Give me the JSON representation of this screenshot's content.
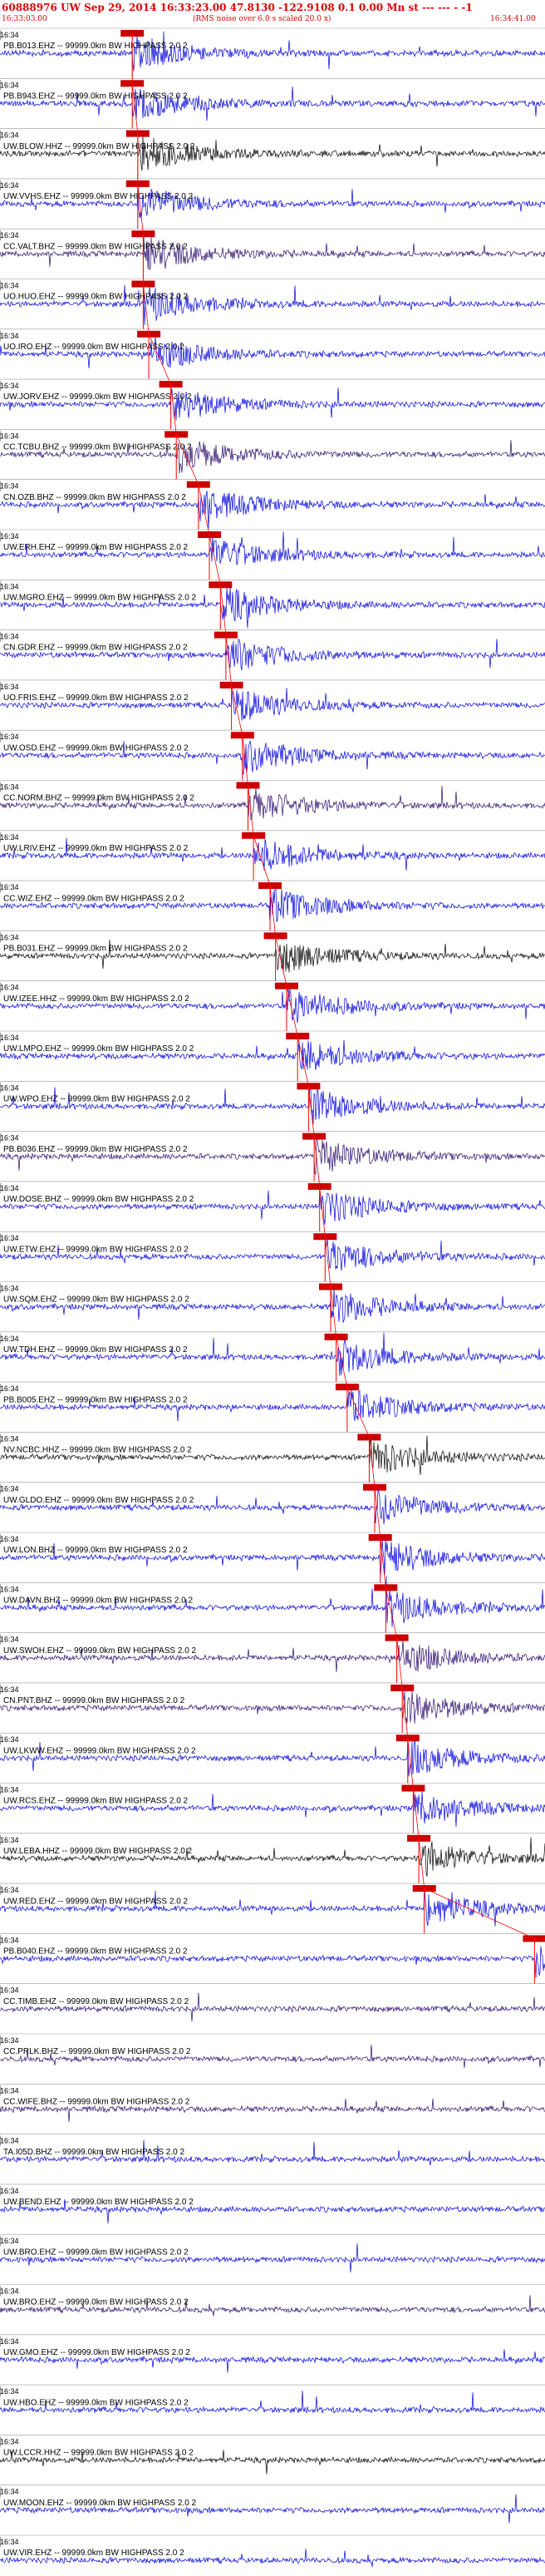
{
  "header": {
    "title": "60888976 UW Sep 29, 2014 16:33:23.00   47.8130 -122.9108  0.1 0.00 Mn st --- --- - -1",
    "start_time": "16:33:03.00",
    "rms_note": "(RMS noise over 6.0 s scaled 20.0 x)",
    "end_time": "16:34:41.00"
  },
  "colors": {
    "header": "#e00000",
    "pick": "#ff0000",
    "pick_box": "#cc0000",
    "traces": [
      "#0000dd",
      "#0000dd",
      "#000000",
      "#0000dd",
      "#2a0a6b",
      "#0000dd",
      "#0000dd",
      "#0000dd",
      "#2a0a6b",
      "#0000dd"
    ]
  },
  "minute_tick_label": "16:34",
  "chart_data": {
    "type": "seismogram_stack",
    "x_label": "",
    "x_range": [
      "16:33:03.00",
      "16:34:41.00"
    ],
    "minute_marker": "16:34",
    "traces": [
      {
        "label": "PB.B013.EHZ -- 99999.0km BW  HIGHPASS  2.0  2",
        "color": "#0000dd",
        "pick": "16:33:27"
      },
      {
        "label": "PB.B943.EHZ -- 99999.0km BW  HIGHPASS  2.0  2",
        "color": "#0000dd",
        "pick": "16:33:27"
      },
      {
        "label": "UW.BLOW.HHZ -- 99999.0km BW  HIGHPASS  2.0  2",
        "color": "#000000",
        "pick": "16:33:28"
      },
      {
        "label": "UW.VVHS.EHZ -- 99999.0km BW  HIGHPASS  2.0  2",
        "color": "#0000dd",
        "pick": "16:33:28"
      },
      {
        "label": "CC.VALT.BHZ -- 99999.0km BW  HIGHPASS  2.0  2",
        "color": "#2a0a6b",
        "pick": "16:33:29"
      },
      {
        "label": "UO.HUO.EHZ -- 99999.0km BW  HIGHPASS  2.0  2",
        "color": "#0000dd",
        "pick": "16:33:29"
      },
      {
        "label": "UO.IRO.EHZ -- 99999.0km BW  HIGHPASS  2.0  2",
        "color": "#0000dd",
        "pick": "16:33:30"
      },
      {
        "label": "UW.JORV.EHZ -- 99999.0km BW  HIGHPASS  2.0  2",
        "color": "#0000dd",
        "pick": "16:33:34"
      },
      {
        "label": "CC.TCBU.BHZ -- 99999.0km BW  HIGHPASS  2.0  2",
        "color": "#2a0a6b",
        "pick": "16:33:35"
      },
      {
        "label": "CN.OZB.BHZ -- 99999.0km BW  HIGHPASS  2.0  2",
        "color": "#0000dd",
        "pick": "16:33:39"
      },
      {
        "label": "UW.ERH.EHZ -- 99999.0km BW  HIGHPASS  2.0  2",
        "color": "#0000dd",
        "pick": "16:33:41"
      },
      {
        "label": "UW.MGRO.EHZ -- 99999.0km BW  HIGHPASS  2.0  2",
        "color": "#0000dd",
        "pick": "16:33:43"
      },
      {
        "label": "CN.GDR.EHZ -- 99999.0km BW  HIGHPASS  2.0  2",
        "color": "#0000dd",
        "pick": "16:33:44"
      },
      {
        "label": "UO.FRIS.EHZ -- 99999.0km BW  HIGHPASS  2.0  2",
        "color": "#0000dd",
        "pick": "16:33:45"
      },
      {
        "label": "UW.OSD.EHZ -- 99999.0km BW  HIGHPASS  2.0  2",
        "color": "#0000dd",
        "pick": "16:33:47"
      },
      {
        "label": "CC.NORM.BHZ -- 99999.0km BW  HIGHPASS  2.0  2",
        "color": "#2a0a6b",
        "pick": "16:33:48"
      },
      {
        "label": "UW.LRIV.EHZ -- 99999.0km BW  HIGHPASS  2.0  2",
        "color": "#0000dd",
        "pick": "16:33:49"
      },
      {
        "label": "CC.WIZ.EHZ -- 99999.0km BW  HIGHPASS  2.0  2",
        "color": "#0000dd",
        "pick": "16:33:52"
      },
      {
        "label": "PB.B031.EHZ -- 99999.0km BW  HIGHPASS  2.0  2",
        "color": "#000000",
        "pick": "16:33:53"
      },
      {
        "label": "UW.IZEE.HHZ -- 99999.0km BW  HIGHPASS  2.0  2",
        "color": "#0000dd",
        "pick": "16:33:55"
      },
      {
        "label": "UW.LMPO.EHZ -- 99999.0km BW  HIGHPASS  2.0  2",
        "color": "#0000dd",
        "pick": "16:33:57"
      },
      {
        "label": "UW.WPO.EHZ -- 99999.0km BW  HIGHPASS  2.0  2",
        "color": "#0000dd",
        "pick": "16:33:59"
      },
      {
        "label": "PB.B036.EHZ -- 99999.0km BW  HIGHPASS  2.0  2",
        "color": "#2a0a6b",
        "pick": "16:34:00"
      },
      {
        "label": "UW.DOSE.BHZ -- 99999.0km BW  HIGHPASS  2.0  2",
        "color": "#0000dd",
        "pick": "16:34:01"
      },
      {
        "label": "UW.ETW.EHZ -- 99999.0km BW  HIGHPASS  2.0  2",
        "color": "#0000dd",
        "pick": "16:34:02"
      },
      {
        "label": "UW.SQM.EHZ -- 99999.0km BW  HIGHPASS  2.0  2",
        "color": "#0000dd",
        "pick": "16:34:03"
      },
      {
        "label": "UW.TDH.EHZ -- 99999.0km BW  HIGHPASS  2.0  2",
        "color": "#0000dd",
        "pick": "16:34:04"
      },
      {
        "label": "PB.B005.EHZ -- 99999.0km BW  HIGHPASS  2.0  2",
        "color": "#0000dd",
        "pick": "16:34:06"
      },
      {
        "label": "NV.NCBC.HHZ -- 99999.0km BW  HIGHPASS  2.0  2",
        "color": "#000000",
        "pick": "16:34:10"
      },
      {
        "label": "UW.GLDO.EHZ -- 99999.0km BW  HIGHPASS  2.0  2",
        "color": "#0000dd",
        "pick": "16:34:11"
      },
      {
        "label": "UW.LON.BHZ -- 99999.0km BW  HIGHPASS  2.0  2",
        "color": "#0000dd",
        "pick": "16:34:12"
      },
      {
        "label": "UW.DAVN.BHZ -- 99999.0km BW  HIGHPASS  2.0  2",
        "color": "#0000dd",
        "pick": "16:34:13"
      },
      {
        "label": "UW.SWOH.EHZ -- 99999.0km BW  HIGHPASS  2.0  2",
        "color": "#2a0a6b",
        "pick": "16:34:15"
      },
      {
        "label": "CN.PNT.BHZ -- 99999.0km BW  HIGHPASS  2.0  2",
        "color": "#2a0a6b",
        "pick": "16:34:16"
      },
      {
        "label": "UW.LKWW.EHZ -- 99999.0km BW  HIGHPASS  2.0  2",
        "color": "#0000dd",
        "pick": "16:34:17"
      },
      {
        "label": "UW.RCS.EHZ -- 99999.0km BW  HIGHPASS  2.0  2",
        "color": "#0000dd",
        "pick": "16:34:18"
      },
      {
        "label": "UW.LEBA.HHZ -- 99999.0km BW  HIGHPASS  2.0  2",
        "color": "#000000",
        "pick": "16:34:19"
      },
      {
        "label": "UW.RED.EHZ -- 99999.0km BW  HIGHPASS  2.0  2",
        "color": "#0000dd",
        "pick": "16:34:20"
      },
      {
        "label": "PB.B040.EHZ -- 99999.0km BW  HIGHPASS  2.0  2",
        "color": "#0000dd",
        "pick": "16:34:40"
      },
      {
        "label": "CC.TIMB.EHZ -- 99999.0km BW  HIGHPASS  2.0  2",
        "color": "#2a0a6b",
        "pick": null
      },
      {
        "label": "CC.PRLK.BHZ -- 99999.0km BW  HIGHPASS  2.0  2",
        "color": "#2a0a6b",
        "pick": null
      },
      {
        "label": "CC.WIFE.BHZ -- 99999.0km BW  HIGHPASS  2.0  2",
        "color": "#2a0a6b",
        "pick": null
      },
      {
        "label": "TA.I05D.BHZ -- 99999.0km BW  HIGHPASS  2.0  2",
        "color": "#0000dd",
        "pick": null
      },
      {
        "label": "UW.BEND.EHZ -- 99999.0km BW  HIGHPASS  2.0  2",
        "color": "#0000dd",
        "pick": null
      },
      {
        "label": "UW.BRO.EHZ -- 99999.0km BW  HIGHPASS  2.0  2",
        "color": "#0000dd",
        "pick": null
      },
      {
        "label": "UW.BRO.EHZ -- 99999.0km BW  HIGHPASS  2.0  2",
        "color": "#2a0a6b",
        "pick": null
      },
      {
        "label": "UW.GMO.EHZ -- 99999.0km BW  HIGHPASS  2.0  2",
        "color": "#0000dd",
        "pick": null
      },
      {
        "label": "UW.HBO.EHZ -- 99999.0km BW  HIGHPASS  2.0  2",
        "color": "#0000dd",
        "pick": null
      },
      {
        "label": "UW.LCCR.HHZ -- 99999.0km BW  HIGHPASS  2.0  2",
        "color": "#000000",
        "pick": null
      },
      {
        "label": "UW.MOON.EHZ -- 99999.0km BW  HIGHPASS  2.0  2",
        "color": "#0000dd",
        "pick": null
      },
      {
        "label": "UW.VIR.EHZ -- 99999.0km BW  HIGHPASS  2.0  2",
        "color": "#0000dd",
        "pick": null
      }
    ]
  }
}
